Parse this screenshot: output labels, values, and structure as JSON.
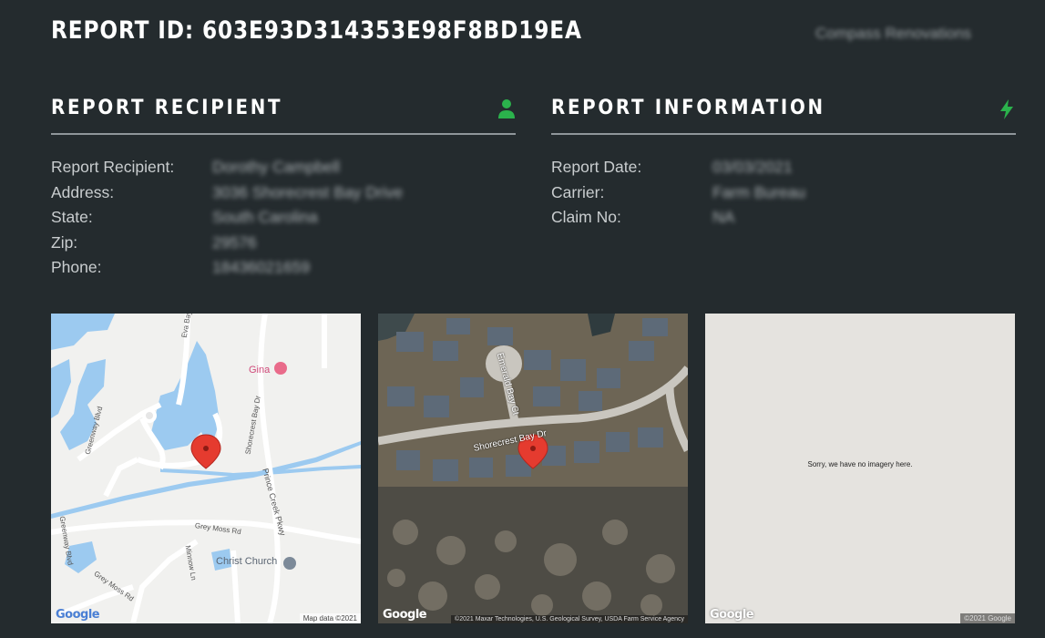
{
  "header": {
    "title": "REPORT ID: 603E93D314353E98F8BD19EA",
    "company": "Compass Renovations"
  },
  "recipient_section": {
    "title": "REPORT RECIPIENT",
    "icon": "user-icon",
    "accent_color": "#2bb24c",
    "fields": [
      {
        "label": "Report Recipient:",
        "value": "Dorothy Campbell"
      },
      {
        "label": "Address:",
        "value": "3036 Shorecrest Bay Drive"
      },
      {
        "label": "State:",
        "value": "South Carolina"
      },
      {
        "label": "Zip:",
        "value": "29576"
      },
      {
        "label": "Phone:",
        "value": "18436021659"
      }
    ]
  },
  "info_section": {
    "title": "REPORT INFORMATION",
    "icon": "lightning-bolt-icon",
    "accent_color": "#2bb24c",
    "fields": [
      {
        "label": "Report Date:",
        "value": "03/03/2021"
      },
      {
        "label": "Carrier:",
        "value": "Farm Bureau"
      },
      {
        "label": "Claim No:",
        "value": "NA"
      }
    ]
  },
  "maps": {
    "roadmap": {
      "logo": "Google",
      "attribution": "Map data ©2021",
      "labels": {
        "eva": "Eva Bay Dr",
        "gina": "Gina",
        "shorecrest": "Shorecrest Bay Dr",
        "greenway": "Greenway Blvd",
        "prince": "Prince Creek Pkwy",
        "greymoss": "Grey Moss Rd",
        "greymoss2": "Grey Moss Rd",
        "greenway2": "Greenway Blvd",
        "minnow": "Minnow Ln",
        "church": "Christ Church"
      }
    },
    "satellite": {
      "logo": "Google",
      "attribution": "©2021 Maxar Technologies, U.S. Geological Survey, USDA Farm Service Agency",
      "labels": {
        "emerald": "Emerald Bay Ct",
        "shorecrest": "Shorecrest Bay Dr"
      }
    },
    "streetview": {
      "logo": "Google",
      "message": "Sorry, we have no imagery here.",
      "attribution": "©2021 Google"
    }
  }
}
